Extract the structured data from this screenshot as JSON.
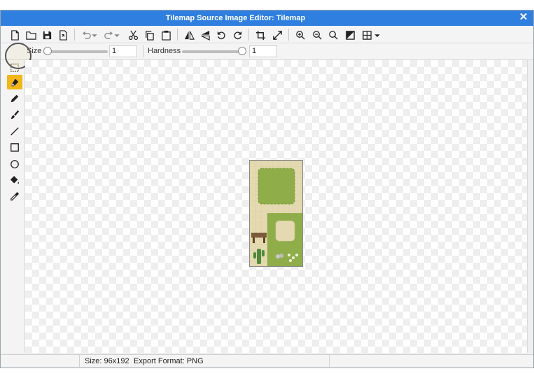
{
  "window": {
    "title": "Tilemap Source Image Editor: Tilemap",
    "close_glyph": "✕"
  },
  "toolbar": {
    "buttons": [
      {
        "name": "new-file-icon"
      },
      {
        "name": "open-folder-icon"
      },
      {
        "name": "save-icon"
      },
      {
        "name": "export-icon"
      },
      {
        "name": "undo-icon"
      },
      {
        "name": "redo-icon"
      },
      {
        "name": "cut-icon"
      },
      {
        "name": "copy-icon"
      },
      {
        "name": "paste-icon"
      },
      {
        "name": "flip-horizontal-icon"
      },
      {
        "name": "flip-vertical-icon"
      },
      {
        "name": "rotate-left-icon"
      },
      {
        "name": "rotate-right-icon"
      },
      {
        "name": "crop-icon"
      },
      {
        "name": "resize-icon"
      },
      {
        "name": "zoom-in-icon"
      },
      {
        "name": "zoom-out-icon"
      },
      {
        "name": "zoom-reset-icon"
      },
      {
        "name": "toggle-background-icon"
      },
      {
        "name": "grid-icon"
      }
    ]
  },
  "options": {
    "size_label": "Size",
    "size_value": "1",
    "size_level": 0.0,
    "hardness_label": "Hardness",
    "hardness_value": "1",
    "hardness_level": 1.0
  },
  "tools": {
    "items": [
      {
        "name": "select-tool-icon",
        "active": false
      },
      {
        "name": "eraser-tool-icon",
        "active": true
      },
      {
        "name": "pencil-tool-icon",
        "active": false
      },
      {
        "name": "brush-tool-icon",
        "active": false
      },
      {
        "name": "line-tool-icon",
        "active": false
      },
      {
        "name": "rectangle-tool-icon",
        "active": false
      },
      {
        "name": "ellipse-tool-icon",
        "active": false
      },
      {
        "name": "fill-tool-icon",
        "active": false
      },
      {
        "name": "eyedropper-tool-icon",
        "active": false
      }
    ],
    "active_color": "#f2b619"
  },
  "status": {
    "size_text": "Size: 96x192",
    "format_text": "Export Format: PNG"
  },
  "colors": {
    "titlebar": "#2f7fe0",
    "sand": "#e4d9b0",
    "grass": "#8fae4a",
    "grass_dark": "#7a9a3a"
  }
}
